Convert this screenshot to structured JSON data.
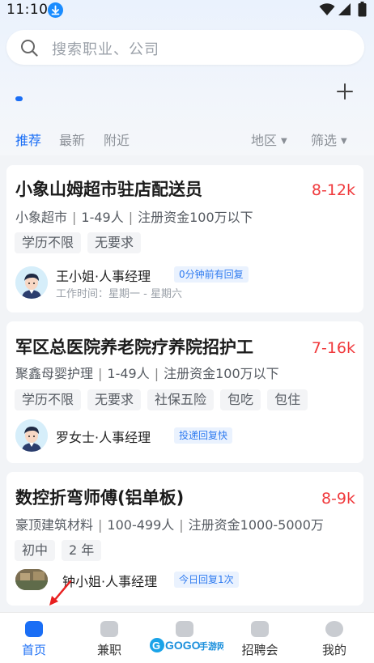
{
  "status_bar": {
    "time": "11:10"
  },
  "search": {
    "placeholder": "搜索职业、公司"
  },
  "tabs": [
    {
      "label": "推荐",
      "active": true
    },
    {
      "label": "最新",
      "active": false
    },
    {
      "label": "附近",
      "active": false
    }
  ],
  "filters": [
    {
      "label": "地区"
    },
    {
      "label": "筛选"
    }
  ],
  "jobs": [
    {
      "title": "小象山姆超市驻店配送员",
      "salary": "8-12k",
      "company": "小象超市",
      "size": "1-49人",
      "capital": "注册资金100万以下",
      "tags": [
        "学历不限",
        "无要求"
      ],
      "recruiter": "王小姐·人事经理",
      "badge": "0分钟前有回复",
      "worktime": "工作时间：星期一 - 星期六"
    },
    {
      "title": "军区总医院养老院疗养院招护工",
      "salary": "7-16k",
      "company": "聚鑫母婴护理",
      "size": "1-49人",
      "capital": "注册资金100万以下",
      "tags": [
        "学历不限",
        "无要求",
        "社保五险",
        "包吃",
        "包住"
      ],
      "recruiter": "罗女士·人事经理",
      "badge": "投递回复快"
    },
    {
      "title": "数控折弯师傅(铝单板)",
      "salary": "8-9k",
      "company": "豪顶建筑材料",
      "size": "100-499人",
      "capital": "注册资金1000-5000万",
      "tags": [
        "初中",
        "2 年"
      ],
      "recruiter": "钟小姐·人事经理",
      "badge": "今日回复1次"
    }
  ],
  "bottom_nav": [
    {
      "label": "首页",
      "icon": "briefcase-icon",
      "active": true
    },
    {
      "label": "兼职",
      "icon": "clock-icon",
      "active": false
    },
    {
      "label": "",
      "icon": "pen-icon",
      "active": false
    },
    {
      "label": "招聘会",
      "icon": "play-icon",
      "active": false
    },
    {
      "label": "我的",
      "icon": "smile-icon",
      "active": false
    }
  ],
  "watermark": {
    "text": "GOGO手游网"
  },
  "colors": {
    "accent": "#1a6ef5",
    "salary": "#f0393c"
  }
}
